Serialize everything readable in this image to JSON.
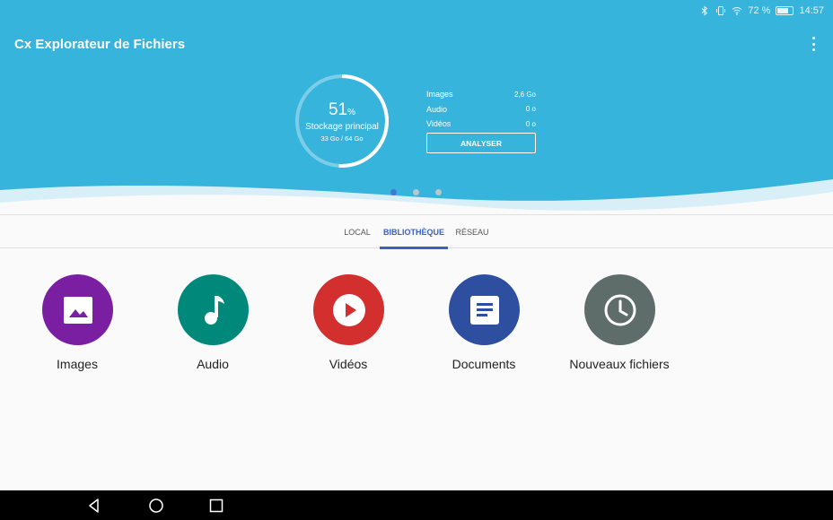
{
  "status_bar": {
    "battery": "72 %",
    "time": "14:57",
    "battery_level": 0.72,
    "icons": [
      "bluetooth-icon",
      "vibrate-icon",
      "wifi-icon",
      "battery-icon"
    ]
  },
  "app": {
    "title": "Cx Explorateur de Fichiers",
    "menu_icon": "more-vertical-icon"
  },
  "storage": {
    "percent": "51",
    "percent_symbol": "%",
    "percent_value": 51,
    "label": "Stockage principal",
    "size": "33 Go / 64 Go",
    "stats": [
      {
        "label": "Images",
        "value": "2,6 Go"
      },
      {
        "label": "Audio",
        "value": "0 o"
      },
      {
        "label": "Vidéos",
        "value": "0 o"
      }
    ],
    "analyse_button": "ANALYSER"
  },
  "pager": {
    "count": 3,
    "active": 0
  },
  "tabs": [
    {
      "label": "LOCAL",
      "active": false
    },
    {
      "label": "BIBLIOTHÈQUE",
      "active": true
    },
    {
      "label": "RÉSEAU",
      "active": false
    }
  ],
  "categories": [
    {
      "label": "Images",
      "icon": "image-icon",
      "color": "#7b1fa2"
    },
    {
      "label": "Audio",
      "icon": "music-note-icon",
      "color": "#00897b"
    },
    {
      "label": "Vidéos",
      "icon": "play-circle-icon",
      "color": "#d32f2f"
    },
    {
      "label": "Documents",
      "icon": "document-icon",
      "color": "#2e4fa0"
    },
    {
      "label": "Nouveaux fichiers",
      "icon": "clock-icon",
      "color": "#5f6d6a"
    }
  ],
  "nav": {
    "icons": [
      "back-icon",
      "home-icon",
      "recents-icon"
    ]
  },
  "colors": {
    "header": "#36b4dc",
    "accent": "#3f5fbf"
  }
}
